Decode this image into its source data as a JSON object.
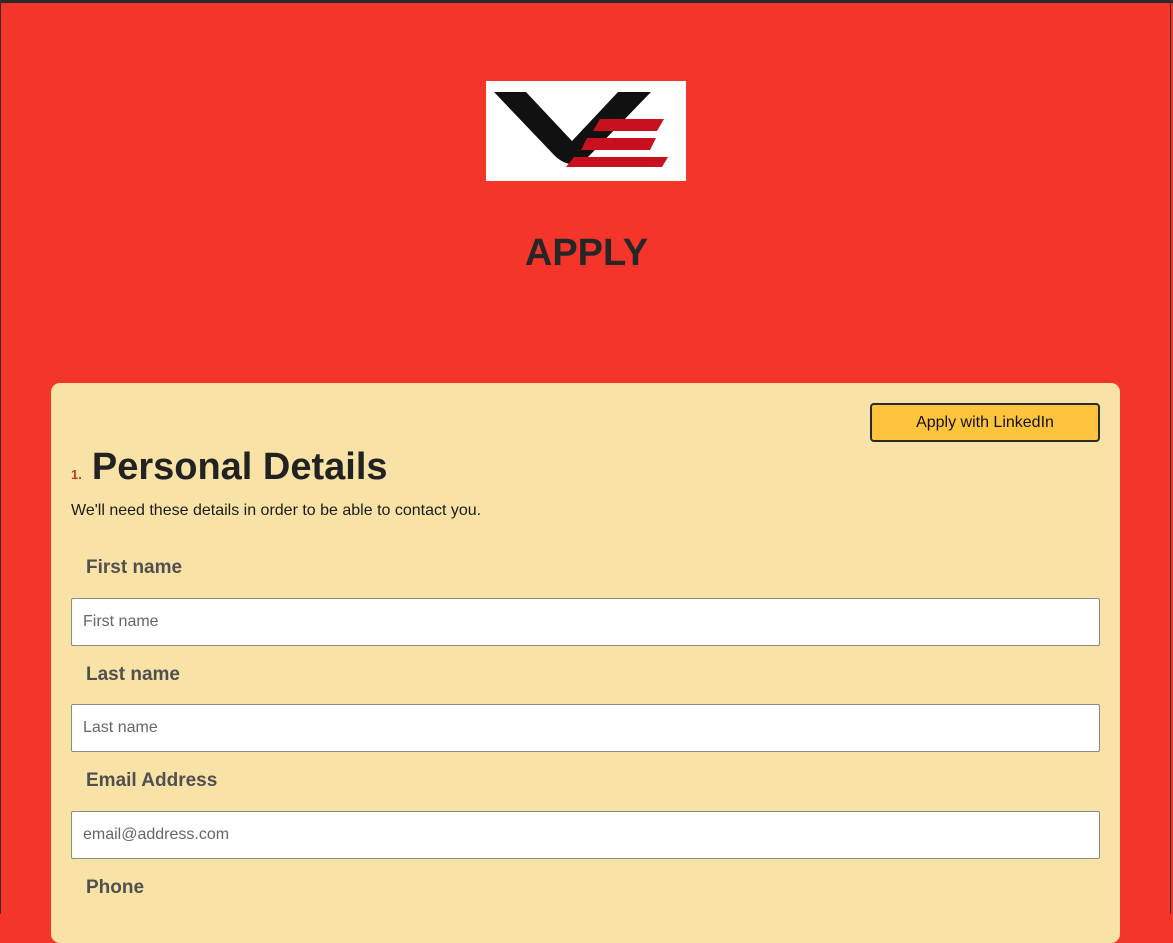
{
  "page": {
    "title": "APPLY",
    "colors": {
      "background": "#f5352a",
      "card": "#f8e2a6",
      "button": "#ffc43d"
    }
  },
  "logo": {
    "icon": "ve-logo"
  },
  "form": {
    "linkedin_label": "Apply with LinkedIn",
    "section": {
      "number": "1.",
      "title": "Personal Details",
      "description": "We'll need these details in order to be able to contact you."
    },
    "fields": [
      {
        "label": "First name",
        "placeholder": "First name",
        "value": ""
      },
      {
        "label": "Last name",
        "placeholder": "Last name",
        "value": ""
      },
      {
        "label": "Email Address",
        "placeholder": "email@address.com",
        "value": ""
      },
      {
        "label": "Phone"
      }
    ]
  }
}
